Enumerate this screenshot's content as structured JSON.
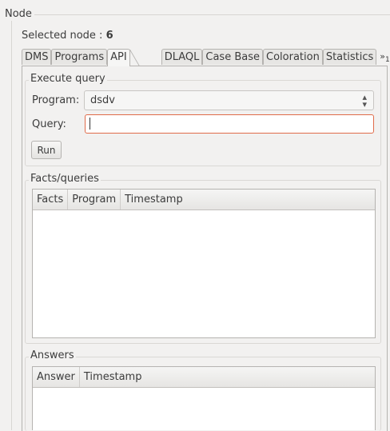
{
  "node": {
    "title": "Node",
    "selected_label": "Selected node :",
    "selected_value": "6"
  },
  "tabs": [
    {
      "label": "DMS",
      "active": false
    },
    {
      "label": "Programs",
      "active": false
    },
    {
      "label": "API",
      "active": true
    },
    {
      "label": "DLAQL",
      "active": false
    },
    {
      "label": "Case Base",
      "active": false
    },
    {
      "label": "Coloration",
      "active": false
    },
    {
      "label": "Statistics",
      "active": false
    }
  ],
  "tab_overflow": {
    "label": "»",
    "count": "1"
  },
  "execute_query": {
    "title": "Execute query",
    "program_label": "Program:",
    "program_value": "dsdv",
    "query_label": "Query:",
    "query_value": "",
    "run_label": "Run"
  },
  "facts": {
    "title": "Facts/queries",
    "columns": [
      "Facts",
      "Program",
      "Timestamp"
    ],
    "rows": []
  },
  "answers": {
    "title": "Answers",
    "columns": [
      "Answer",
      "Timestamp"
    ],
    "rows": []
  },
  "colors": {
    "focus_border": "#e06b4a",
    "window_bg": "#f2f1f0"
  }
}
